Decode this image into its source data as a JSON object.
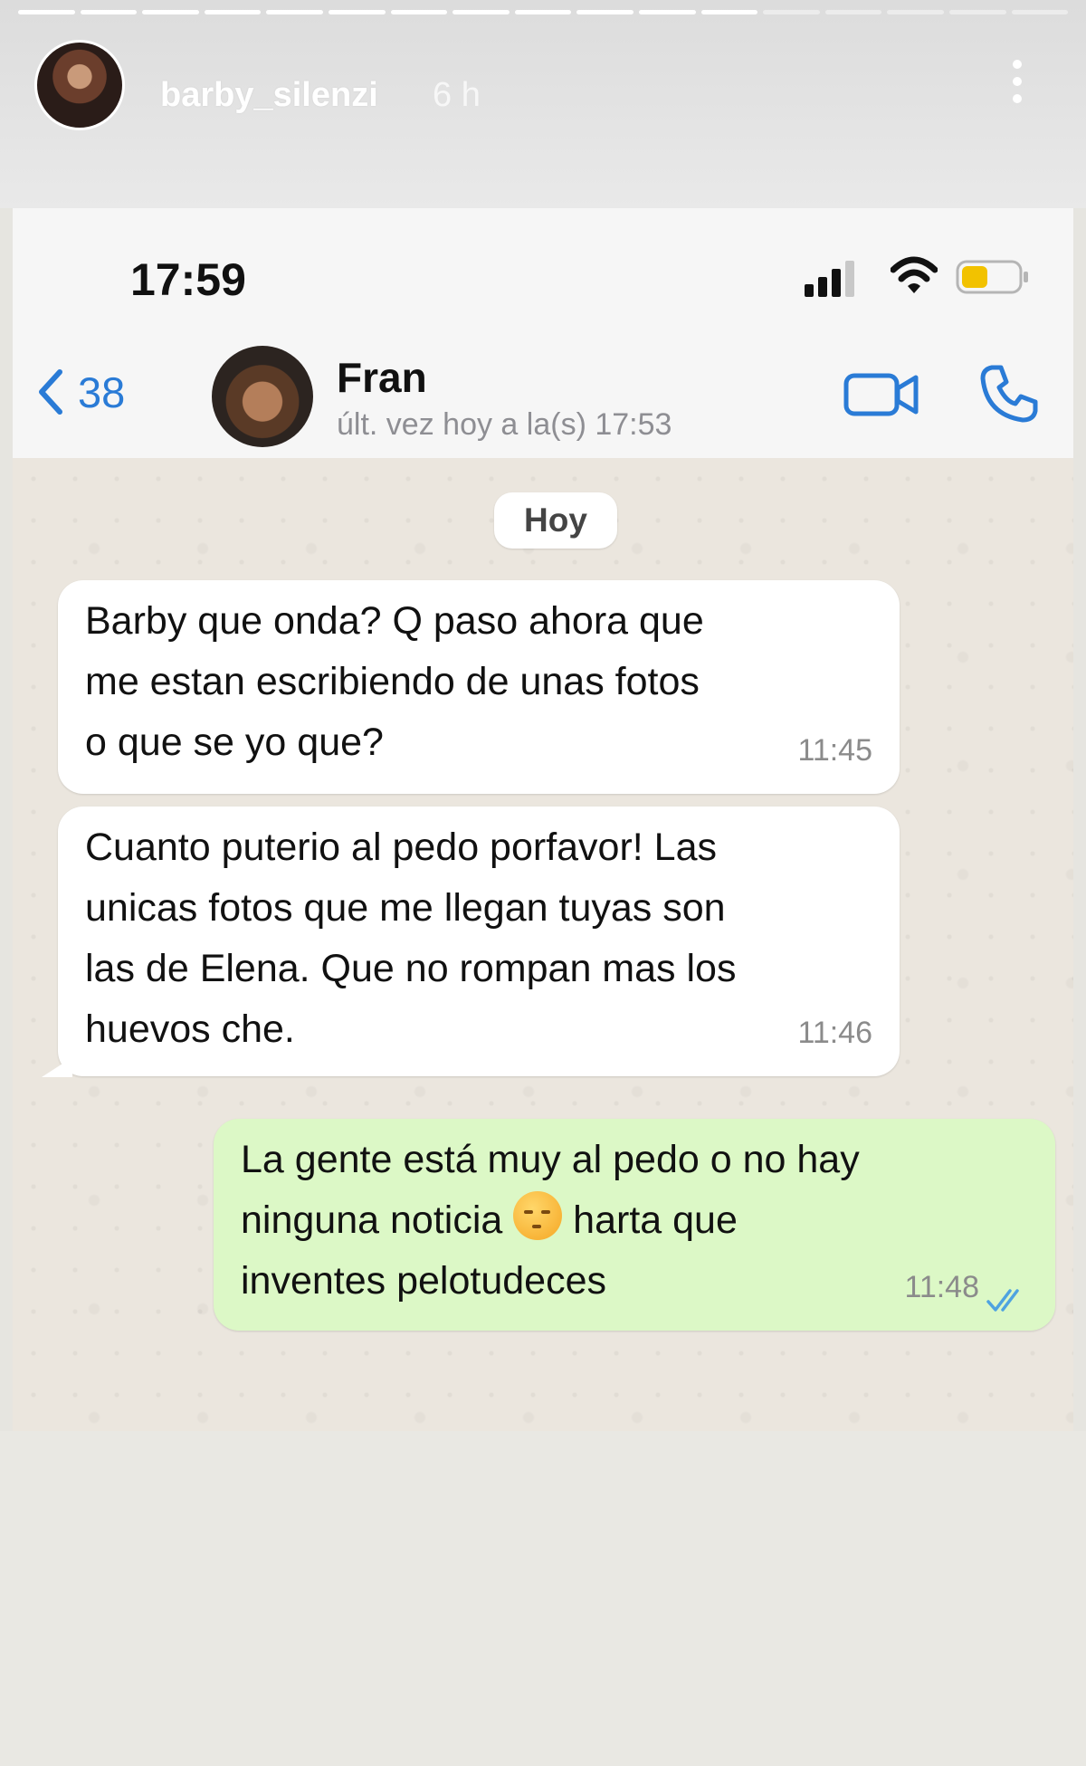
{
  "story": {
    "username": "barby_silenzi",
    "time_ago": "6 h",
    "progress_segments": 17,
    "progress_done": 12
  },
  "phone": {
    "clock": "17:59",
    "icons": [
      "signal-icon",
      "wifi-icon",
      "battery-icon"
    ]
  },
  "chat_header": {
    "back_count": "38",
    "contact_name": "Fran",
    "contact_status": "últ. vez hoy a la(s) 17:53",
    "icons": [
      "chevron-left-icon",
      "video-call-icon",
      "phone-icon"
    ],
    "accent_color": "#2a7bd6"
  },
  "chat": {
    "date_label": "Hoy",
    "messages": [
      {
        "direction": "incoming",
        "text": "Barby que onda? Q paso ahora que\nme estan escribiendo de unas fotos\no que se yo que?",
        "time": "11:45"
      },
      {
        "direction": "incoming",
        "text": "Cuanto puterio al pedo porfavor! Las\nunicas fotos que me llegan tuyas son\nlas de Elena. Que no rompan mas los\nhuevos che.",
        "time": "11:46"
      },
      {
        "direction": "outgoing",
        "text_before_emoji": "La gente está muy al pedo o no hay\nninguna noticia ",
        "emoji": "😒",
        "text_after_emoji": " harta que\ninventes pelotudeces",
        "time": "11:48",
        "status": "read"
      }
    ],
    "colors": {
      "incoming_bubble": "#ffffff",
      "outgoing_bubble": "#dcf8c6",
      "read_ticks": "#4fa3e0"
    }
  }
}
